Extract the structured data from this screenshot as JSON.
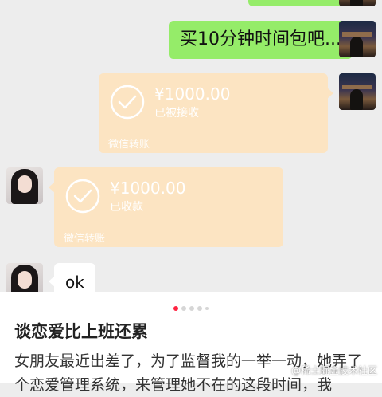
{
  "messages": [
    {
      "type": "text",
      "from": "me",
      "text": "买10分钟时间包吧..."
    },
    {
      "type": "transfer",
      "from": "me",
      "amount": "¥1000.00",
      "status": "已被接收",
      "footer": "微信转账"
    },
    {
      "type": "transfer",
      "from": "her",
      "amount": "¥1000.00",
      "status": "已收款",
      "footer": "微信转账"
    },
    {
      "type": "text",
      "from": "her",
      "text": "ok"
    }
  ],
  "carousel": {
    "count": 5,
    "active_index": 0
  },
  "post": {
    "title": "谈恋爱比上班还累",
    "body": "女朋友最近出差了，为了监督我的一举一动，她弄了个恋爱管理系统，来管理她不在的这段时间，我"
  },
  "watermark": "@稀土掘金技术社区",
  "colors": {
    "green_bubble": "#95ec69",
    "transfer_card": "#fce4c2",
    "chat_bg": "#ededed",
    "active_dot": "#ff2442"
  }
}
